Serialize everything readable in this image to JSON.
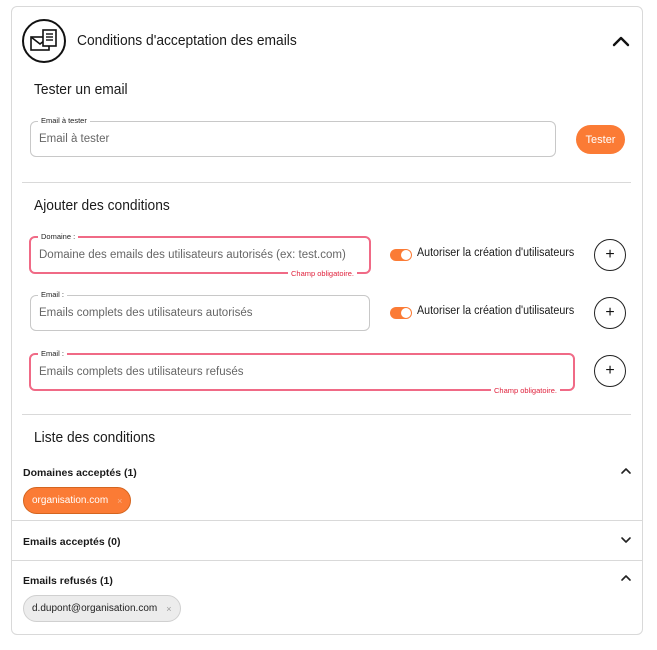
{
  "header": {
    "title": "Conditions d'acceptation des emails",
    "icon": "email-settings-icon",
    "chevron": "chevron-up-icon"
  },
  "test_section": {
    "title": "Tester un email",
    "field_label": "Email à tester",
    "field_placeholder": "Email à tester",
    "field_value": "",
    "button_label": "Tester"
  },
  "add_section": {
    "title": "Ajouter des conditions",
    "rows": [
      {
        "label": "Domaine :",
        "placeholder": "Domaine des emails des utilisateurs autorisés (ex: test.com)",
        "error": "Champ obligatoire.",
        "toggle_label": "Autoriser la création d'utilisateurs",
        "toggle_on": true
      },
      {
        "label": "Email :",
        "placeholder": "Emails complets des utilisateurs autorisés",
        "toggle_label": "Autoriser la création d'utilisateurs",
        "toggle_on": true
      },
      {
        "label": "Email :",
        "placeholder": "Emails complets des utilisateurs refusés",
        "error": "Champ obligatoire."
      }
    ],
    "add_button_label": "+"
  },
  "list_section": {
    "title": "Liste des conditions",
    "groups": [
      {
        "title": "Domaines acceptés (1)",
        "expanded": true,
        "chips": [
          "organisation.com"
        ]
      },
      {
        "title": "Emails acceptés (0)",
        "expanded": false,
        "chips": []
      },
      {
        "title": "Emails refusés (1)",
        "expanded": true,
        "chips": [
          "d.dupont@organisation.com"
        ]
      }
    ],
    "chip_remove": "×"
  },
  "colors": {
    "accent": "#fb7b35",
    "error": "#e0213c",
    "error_border": "#f06a86"
  }
}
